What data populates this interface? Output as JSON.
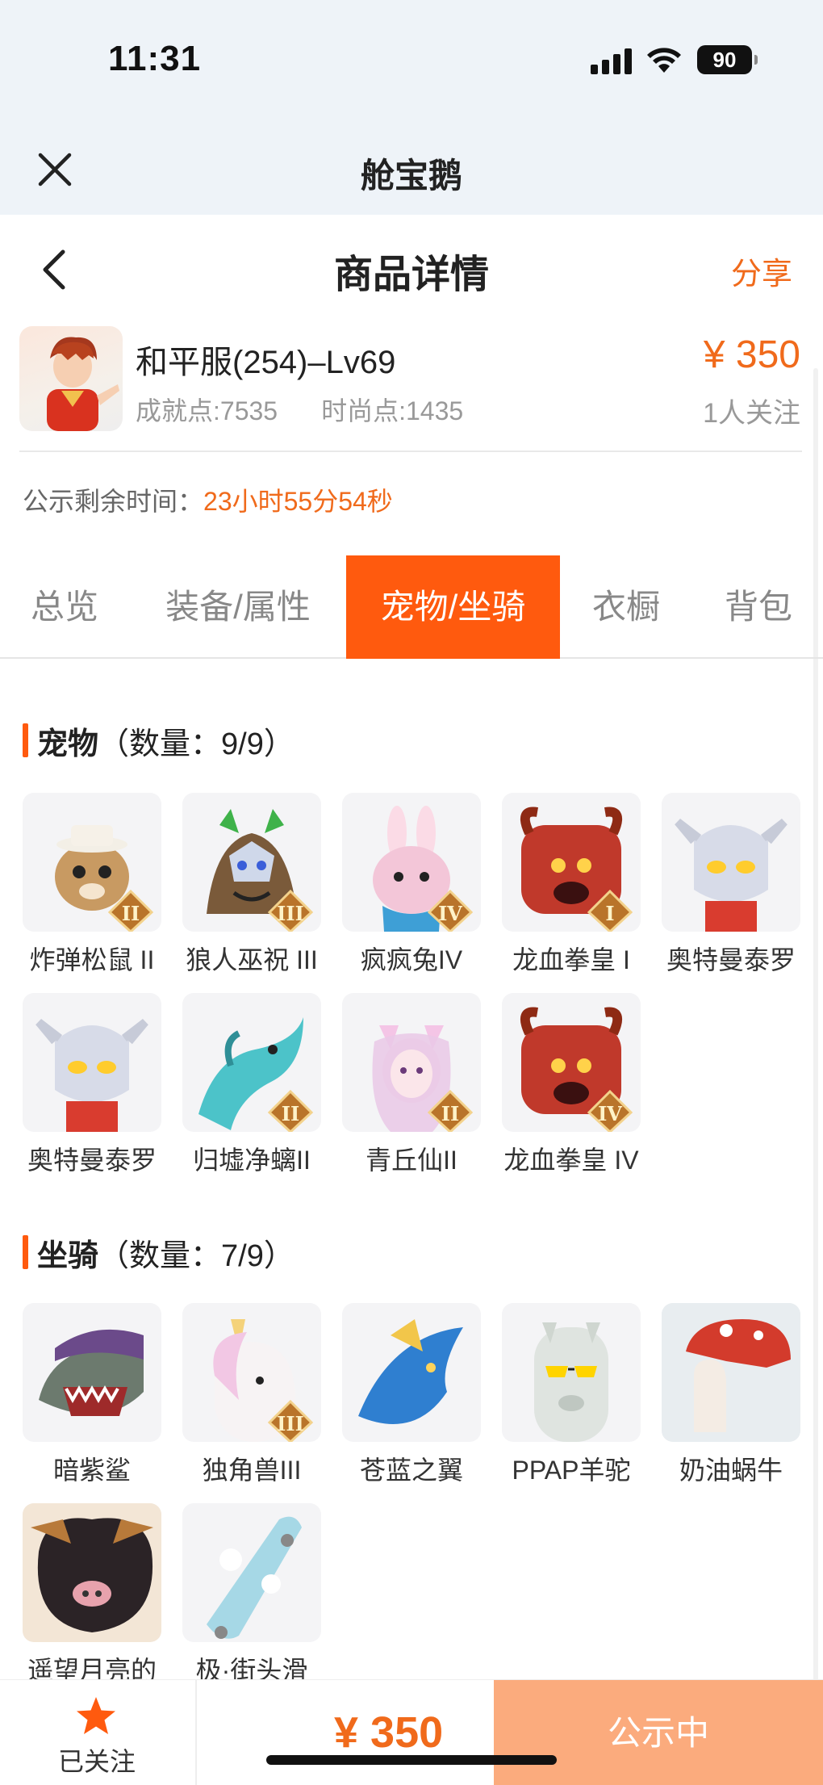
{
  "status_bar": {
    "time": "11:31",
    "battery": "90"
  },
  "app": {
    "name": "舱宝鹅"
  },
  "header": {
    "title": "商品详情",
    "share": "分享"
  },
  "product": {
    "name": "和平服(254)–Lv69",
    "achievement": "成就点:7535",
    "fashion": "时尚点:1435",
    "price": "¥ 350",
    "followers": "1人关注",
    "timer_label": "公示剩余时间：",
    "timer_value": "23小时55分54秒"
  },
  "tabs": [
    "总览",
    "装备/属性",
    "宠物/坐骑",
    "衣橱",
    "背包"
  ],
  "active_tab": 2,
  "pets": {
    "title": "宠物",
    "count": "（数量：9/9）",
    "items": [
      {
        "label": "炸弹松鼠 II",
        "icon": "squirrel",
        "color": "#c89a62",
        "rank": "II"
      },
      {
        "label": "狼人巫祝 III",
        "icon": "wolf",
        "color": "#7a5a3a",
        "rank": "III"
      },
      {
        "label": "疯疯兔IV",
        "icon": "rabbit",
        "color": "#f3c6d8",
        "rank": "IV"
      },
      {
        "label": "龙血拳皇 I",
        "icon": "dragon-fist",
        "color": "#c0392b",
        "rank": "I"
      },
      {
        "label": "奥特曼泰罗",
        "icon": "ultraman",
        "color": "#d7dbe8",
        "rank": ""
      },
      {
        "label": "奥特曼泰罗",
        "icon": "ultraman",
        "color": "#d7dbe8",
        "rank": ""
      },
      {
        "label": "归墟净螭II",
        "icon": "sea-dragon",
        "color": "#4cc3c9",
        "rank": "II"
      },
      {
        "label": "青丘仙II",
        "icon": "fox-fairy",
        "color": "#e9c8e6",
        "rank": "II"
      },
      {
        "label": "龙血拳皇 IV",
        "icon": "dragon-fist",
        "color": "#c0392b",
        "rank": "IV"
      }
    ]
  },
  "mounts": {
    "title": "坐骑",
    "count": "（数量：7/9）",
    "items": [
      {
        "label": "暗紫鲨",
        "icon": "shark",
        "color": "#6b4a8a",
        "rank": ""
      },
      {
        "label": "独角兽III",
        "icon": "unicorn",
        "color": "#f2c7e4",
        "rank": "III"
      },
      {
        "label": "苍蓝之翼",
        "icon": "blue-wing",
        "color": "#2f7fd0",
        "rank": ""
      },
      {
        "label": "PPAP羊驼",
        "icon": "alpaca",
        "color": "#dfe4e0",
        "rank": ""
      },
      {
        "label": "奶油蜗牛",
        "icon": "snail",
        "color": "#e8edf0",
        "rank": ""
      },
      {
        "label": "遥望月亮的",
        "icon": "pig",
        "color": "#2b2326",
        "rank": ""
      },
      {
        "label": "极·街头滑",
        "icon": "skateboard",
        "color": "#a6d8e6",
        "rank": ""
      }
    ]
  },
  "bottom_bar": {
    "followed": "已关注",
    "price": "¥ 350",
    "status": "公示中"
  },
  "colors": {
    "accent": "#ff5a0e",
    "price": "#f06a1b",
    "cta": "#fbab7d"
  }
}
